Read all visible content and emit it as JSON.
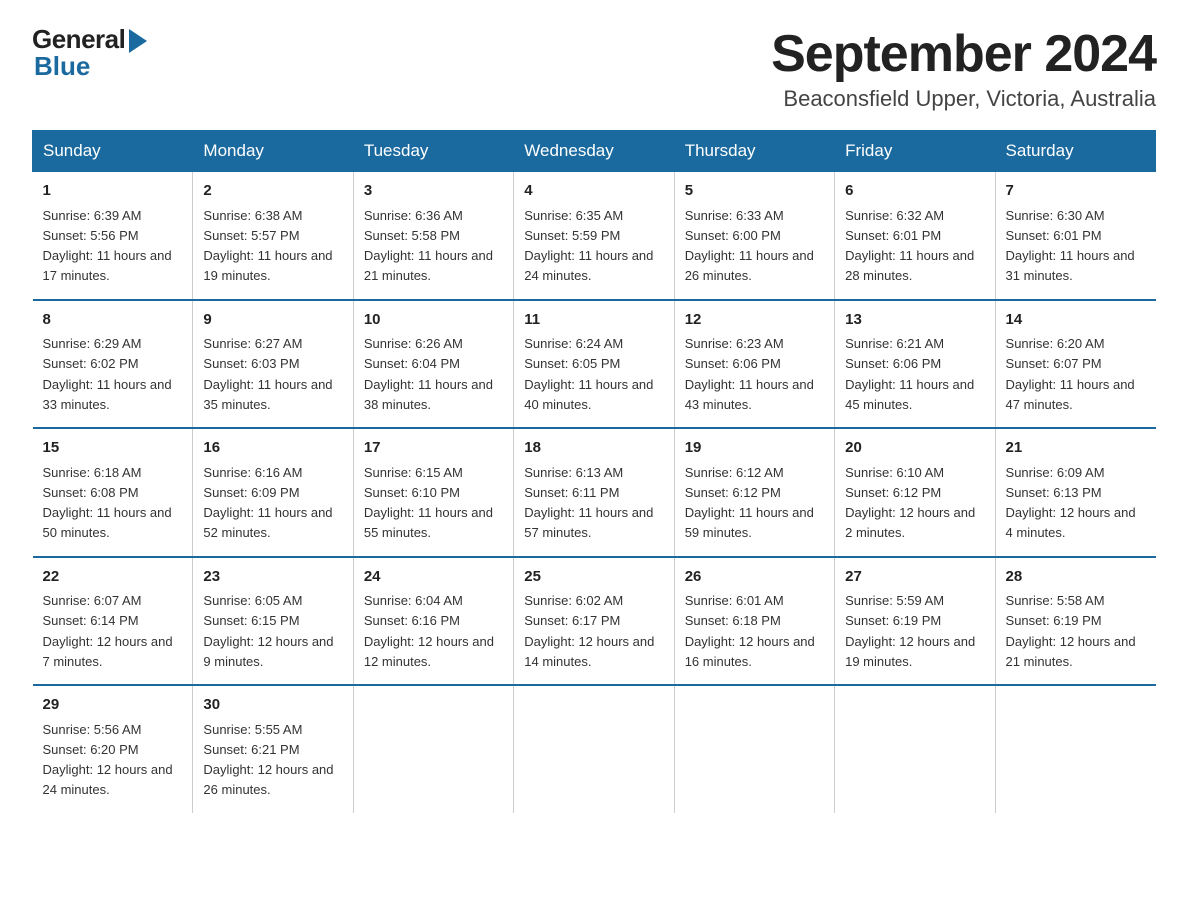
{
  "header": {
    "logo_general": "General",
    "logo_blue": "Blue",
    "title": "September 2024",
    "subtitle": "Beaconsfield Upper, Victoria, Australia"
  },
  "weekdays": [
    "Sunday",
    "Monday",
    "Tuesday",
    "Wednesday",
    "Thursday",
    "Friday",
    "Saturday"
  ],
  "weeks": [
    [
      {
        "day": "1",
        "sunrise": "6:39 AM",
        "sunset": "5:56 PM",
        "daylight": "11 hours and 17 minutes."
      },
      {
        "day": "2",
        "sunrise": "6:38 AM",
        "sunset": "5:57 PM",
        "daylight": "11 hours and 19 minutes."
      },
      {
        "day": "3",
        "sunrise": "6:36 AM",
        "sunset": "5:58 PM",
        "daylight": "11 hours and 21 minutes."
      },
      {
        "day": "4",
        "sunrise": "6:35 AM",
        "sunset": "5:59 PM",
        "daylight": "11 hours and 24 minutes."
      },
      {
        "day": "5",
        "sunrise": "6:33 AM",
        "sunset": "6:00 PM",
        "daylight": "11 hours and 26 minutes."
      },
      {
        "day": "6",
        "sunrise": "6:32 AM",
        "sunset": "6:01 PM",
        "daylight": "11 hours and 28 minutes."
      },
      {
        "day": "7",
        "sunrise": "6:30 AM",
        "sunset": "6:01 PM",
        "daylight": "11 hours and 31 minutes."
      }
    ],
    [
      {
        "day": "8",
        "sunrise": "6:29 AM",
        "sunset": "6:02 PM",
        "daylight": "11 hours and 33 minutes."
      },
      {
        "day": "9",
        "sunrise": "6:27 AM",
        "sunset": "6:03 PM",
        "daylight": "11 hours and 35 minutes."
      },
      {
        "day": "10",
        "sunrise": "6:26 AM",
        "sunset": "6:04 PM",
        "daylight": "11 hours and 38 minutes."
      },
      {
        "day": "11",
        "sunrise": "6:24 AM",
        "sunset": "6:05 PM",
        "daylight": "11 hours and 40 minutes."
      },
      {
        "day": "12",
        "sunrise": "6:23 AM",
        "sunset": "6:06 PM",
        "daylight": "11 hours and 43 minutes."
      },
      {
        "day": "13",
        "sunrise": "6:21 AM",
        "sunset": "6:06 PM",
        "daylight": "11 hours and 45 minutes."
      },
      {
        "day": "14",
        "sunrise": "6:20 AM",
        "sunset": "6:07 PM",
        "daylight": "11 hours and 47 minutes."
      }
    ],
    [
      {
        "day": "15",
        "sunrise": "6:18 AM",
        "sunset": "6:08 PM",
        "daylight": "11 hours and 50 minutes."
      },
      {
        "day": "16",
        "sunrise": "6:16 AM",
        "sunset": "6:09 PM",
        "daylight": "11 hours and 52 minutes."
      },
      {
        "day": "17",
        "sunrise": "6:15 AM",
        "sunset": "6:10 PM",
        "daylight": "11 hours and 55 minutes."
      },
      {
        "day": "18",
        "sunrise": "6:13 AM",
        "sunset": "6:11 PM",
        "daylight": "11 hours and 57 minutes."
      },
      {
        "day": "19",
        "sunrise": "6:12 AM",
        "sunset": "6:12 PM",
        "daylight": "11 hours and 59 minutes."
      },
      {
        "day": "20",
        "sunrise": "6:10 AM",
        "sunset": "6:12 PM",
        "daylight": "12 hours and 2 minutes."
      },
      {
        "day": "21",
        "sunrise": "6:09 AM",
        "sunset": "6:13 PM",
        "daylight": "12 hours and 4 minutes."
      }
    ],
    [
      {
        "day": "22",
        "sunrise": "6:07 AM",
        "sunset": "6:14 PM",
        "daylight": "12 hours and 7 minutes."
      },
      {
        "day": "23",
        "sunrise": "6:05 AM",
        "sunset": "6:15 PM",
        "daylight": "12 hours and 9 minutes."
      },
      {
        "day": "24",
        "sunrise": "6:04 AM",
        "sunset": "6:16 PM",
        "daylight": "12 hours and 12 minutes."
      },
      {
        "day": "25",
        "sunrise": "6:02 AM",
        "sunset": "6:17 PM",
        "daylight": "12 hours and 14 minutes."
      },
      {
        "day": "26",
        "sunrise": "6:01 AM",
        "sunset": "6:18 PM",
        "daylight": "12 hours and 16 minutes."
      },
      {
        "day": "27",
        "sunrise": "5:59 AM",
        "sunset": "6:19 PM",
        "daylight": "12 hours and 19 minutes."
      },
      {
        "day": "28",
        "sunrise": "5:58 AM",
        "sunset": "6:19 PM",
        "daylight": "12 hours and 21 minutes."
      }
    ],
    [
      {
        "day": "29",
        "sunrise": "5:56 AM",
        "sunset": "6:20 PM",
        "daylight": "12 hours and 24 minutes."
      },
      {
        "day": "30",
        "sunrise": "5:55 AM",
        "sunset": "6:21 PM",
        "daylight": "12 hours and 26 minutes."
      },
      null,
      null,
      null,
      null,
      null
    ]
  ]
}
